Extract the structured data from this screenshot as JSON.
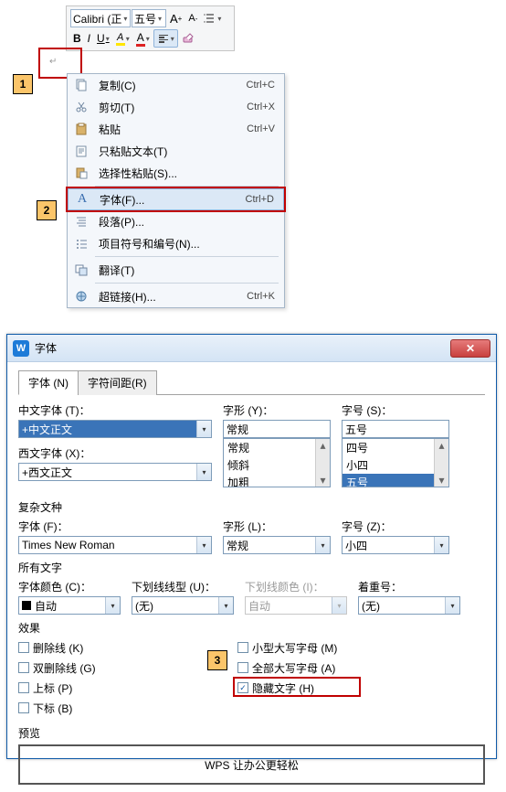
{
  "annotations": {
    "tag1": "1",
    "tag2": "2",
    "tag3": "3"
  },
  "toolbar": {
    "font_name": "Calibri (正",
    "font_size": "五号",
    "grow_font": "A",
    "shrink_font": "A",
    "bold": "B",
    "italic": "I",
    "underline": "U",
    "highlight_letter": "A",
    "fontcolor_letter": "A"
  },
  "ctx": {
    "copy": {
      "label": "复制(C)",
      "shortcut": "Ctrl+C"
    },
    "cut": {
      "label": "剪切(T)",
      "shortcut": "Ctrl+X"
    },
    "paste": {
      "label": "粘贴",
      "shortcut": "Ctrl+V"
    },
    "paste_text": {
      "label": "只粘贴文本(T)"
    },
    "paste_spec": {
      "label": "选择性粘贴(S)..."
    },
    "font": {
      "label": "字体(F)...",
      "shortcut": "Ctrl+D"
    },
    "paragraph": {
      "label": "段落(P)..."
    },
    "bullets": {
      "label": "项目符号和编号(N)..."
    },
    "translate": {
      "label": "翻译(T)"
    },
    "hyperlink": {
      "label": "超链接(H)...",
      "shortcut": "Ctrl+K"
    }
  },
  "dialog": {
    "title": "字体",
    "tabs": {
      "font": "字体 (N)",
      "spacing": "字符间距(R)"
    },
    "cn_font_label": "中文字体 (T)：",
    "cn_font_value": "+中文正文",
    "style_label": "字形 (Y)：",
    "style_value": "常规",
    "style_options": [
      "常规",
      "倾斜",
      "加粗"
    ],
    "size_label": "字号 (S)：",
    "size_value": "五号",
    "size_options": [
      "四号",
      "小四",
      "五号"
    ],
    "west_font_label": "西文字体 (X)：",
    "west_font_value": "+西文正文",
    "complex_group": "复杂文种",
    "complex_font_label": "字体 (F)：",
    "complex_font_value": "Times New Roman",
    "complex_style_label": "字形 (L)：",
    "complex_style_value": "常规",
    "complex_size_label": "字号 (Z)：",
    "complex_size_value": "小四",
    "all_text_group": "所有文字",
    "font_color_label": "字体颜色 (C)：",
    "font_color_value": "自动",
    "underline_style_label": "下划线线型 (U)：",
    "underline_style_value": "(无)",
    "underline_color_label": "下划线颜色 (I)：",
    "underline_color_value": "自动",
    "emphasis_label": "着重号：",
    "emphasis_value": "(无)",
    "effects_group": "效果",
    "strike": "删除线 (K)",
    "dbl_strike": "双删除线 (G)",
    "super": "上标 (P)",
    "sub": "下标 (B)",
    "small_caps": "小型大写字母 (M)",
    "all_caps": "全部大写字母 (A)",
    "hidden": "隐藏文字 (H)",
    "preview_group": "预览",
    "preview_text": "WPS 让办公更轻松"
  }
}
